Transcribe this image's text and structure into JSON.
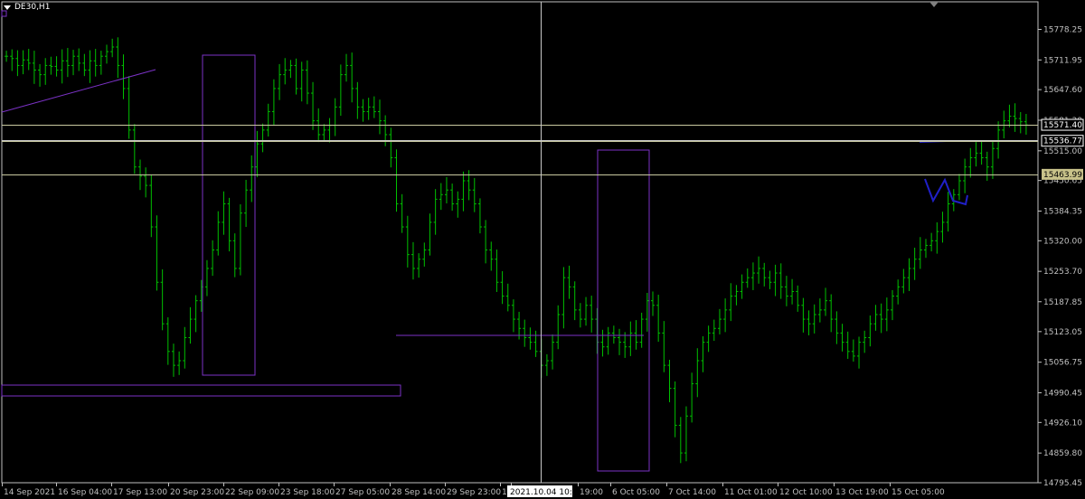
{
  "header": {
    "symbol": "DE30,H1"
  },
  "colors": {
    "background": "#000000",
    "candle": "#00c000",
    "axis": "#c0c0c0",
    "level_line": "#c8c8a0",
    "object": "#7b32c6",
    "sketch": "#2020c8",
    "crosshair": "#c8c8c8"
  },
  "chart_data": {
    "type": "line",
    "title": "DE30,H1",
    "ylim": [
      14795.45,
      15838
    ],
    "y_ticks": [
      "15778.25",
      "15711.95",
      "15647.60",
      "15581.30",
      "15515.00",
      "15450.65",
      "15384.35",
      "15320.00",
      "15253.70",
      "15187.85",
      "15123.05",
      "15056.75",
      "14990.45",
      "14926.10",
      "14859.80",
      "14795.45"
    ],
    "x_ticks": [
      "14 Sep 2021",
      "16 Sep 04:00",
      "17 Sep 13:00",
      "20 Sep 23:00",
      "22 Sep 09:00",
      "23 Sep 18:00",
      "27 Sep 05:00",
      "28 Sep 14:00",
      "29 Sep 23:00",
      "1",
      "2021.10.04 10:00",
      "19:00",
      "6 Oct 05:00",
      "7 Oct 14:00",
      "11 Oct 01:00",
      "12 Oct 10:00",
      "13 Oct 19:00",
      "15 Oct 05:00"
    ],
    "x_tick_highlight": "2021.10.04 10:00",
    "series": [
      {
        "values": [
          15720,
          15715,
          15700,
          15712,
          15705,
          15690,
          15680,
          15700,
          15698,
          15690,
          15710,
          15700,
          15720,
          15705,
          15690,
          15710,
          15700,
          15720,
          15730,
          15740,
          15700,
          15650,
          15560,
          15480,
          15460,
          15440,
          15350,
          15230,
          15140,
          15080,
          15050,
          15060,
          15110,
          15150,
          15190,
          15220,
          15260,
          15300,
          15360,
          15400,
          15320,
          15260,
          15380,
          15430,
          15480,
          15530,
          15560,
          15600,
          15650,
          15680,
          15690,
          15700,
          15650,
          15690,
          15640,
          15580,
          15550,
          15560,
          15570,
          15610,
          15680,
          15700,
          15650,
          15610,
          15600,
          15610,
          15600,
          15580,
          15550,
          15500,
          15400,
          15350,
          15290,
          15260,
          15280,
          15300,
          15360,
          15410,
          15420,
          15430,
          15400,
          15410,
          15450,
          15430,
          15400,
          15350,
          15300,
          15280,
          15230,
          15200,
          15180,
          15150,
          15130,
          15110,
          15100,
          15080,
          15050,
          15060,
          15100,
          15160,
          15240,
          15220,
          15170,
          15150,
          15180,
          15150,
          15100,
          15090,
          15120,
          15110,
          15100,
          15090,
          15120,
          15100,
          15150,
          15190,
          15180,
          15120,
          15050,
          15000,
          14920,
          14860,
          14940,
          15010,
          15060,
          15100,
          15120,
          15130,
          15150,
          15170,
          15200,
          15210,
          15230,
          15240,
          15250,
          15260,
          15240,
          15230,
          15250,
          15220,
          15200,
          15210,
          15180,
          15150,
          15140,
          15160,
          15170,
          15190,
          15150,
          15120,
          15100,
          15080,
          15070,
          15100,
          15110,
          15140,
          15160,
          15150,
          15170,
          15200,
          15220,
          15240,
          15260,
          15280,
          15300,
          15310,
          15320,
          15340,
          15360,
          15400,
          15420,
          15450,
          15480,
          15500,
          15510,
          15500,
          15480,
          15520,
          15560,
          15580,
          15590,
          15585,
          15578,
          15571
        ]
      }
    ],
    "levels": [
      {
        "label": "15571.40",
        "value": 15571.4
      },
      {
        "label": "15536.77",
        "value": 15536.77
      },
      {
        "label": "15463.99",
        "value": 15463.99
      }
    ]
  }
}
